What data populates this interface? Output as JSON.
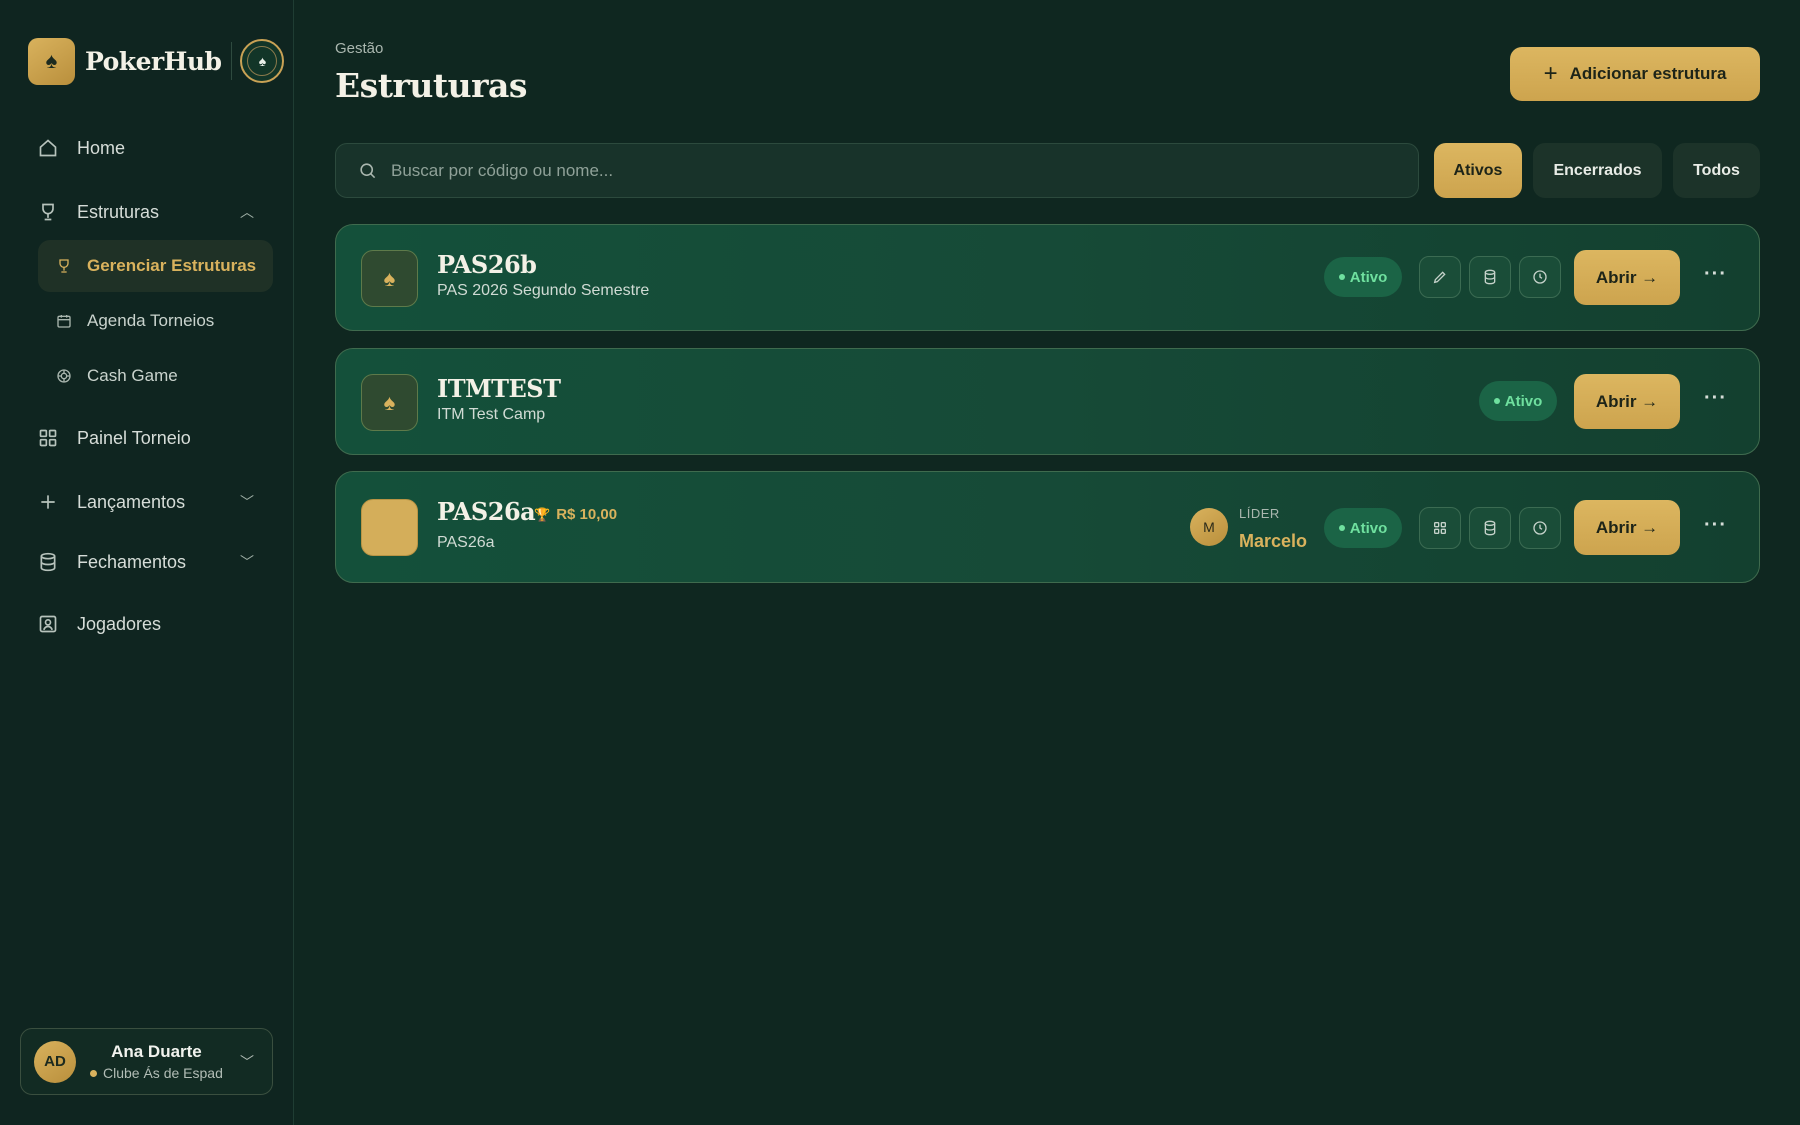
{
  "brand": {
    "name": "PokerHub",
    "logo_icon": "spade-icon",
    "club_icon": "club-seal-icon"
  },
  "sidebar": {
    "home": "Home",
    "estruturas": "Estruturas",
    "gerenciar": "Gerenciar Estruturas",
    "agenda": "Agenda Torneios",
    "cash": "Cash Game",
    "painel": "Painel Torneio",
    "lancamentos": "Lançamentos",
    "fechamentos": "Fechamentos",
    "jogadores": "Jogadores"
  },
  "user": {
    "initials": "AD",
    "name": "Ana Duarte",
    "club": "Clube Ás de Espad"
  },
  "header": {
    "breadcrumb": "Gestão",
    "title": "Estruturas",
    "add_label": "Adicionar estrutura"
  },
  "search": {
    "placeholder": "Buscar por código ou nome..."
  },
  "filters": {
    "active": "Ativos",
    "closed": "Encerrados",
    "all": "Todos"
  },
  "cards": [
    {
      "code": "PAS26b",
      "name": "PAS 2026 Segundo Semestre",
      "status": "Ativo",
      "open": "Abrir →",
      "more": "···"
    },
    {
      "code": "ITMTEST",
      "name": "ITM Test Camp",
      "status": "Ativo",
      "open": "Abrir →",
      "more": "···"
    },
    {
      "code": "PAS26a",
      "name": "PAS26a",
      "prize": "R$ 10,00",
      "status": "Ativo",
      "open": "Abrir →",
      "more": "···",
      "leader": {
        "initial": "M",
        "label": "LÍDER",
        "name": "Marcelo"
      }
    }
  ],
  "colors": {
    "accent": "#d9b25d",
    "background": "#0f2720",
    "status": "#6fe09f"
  }
}
